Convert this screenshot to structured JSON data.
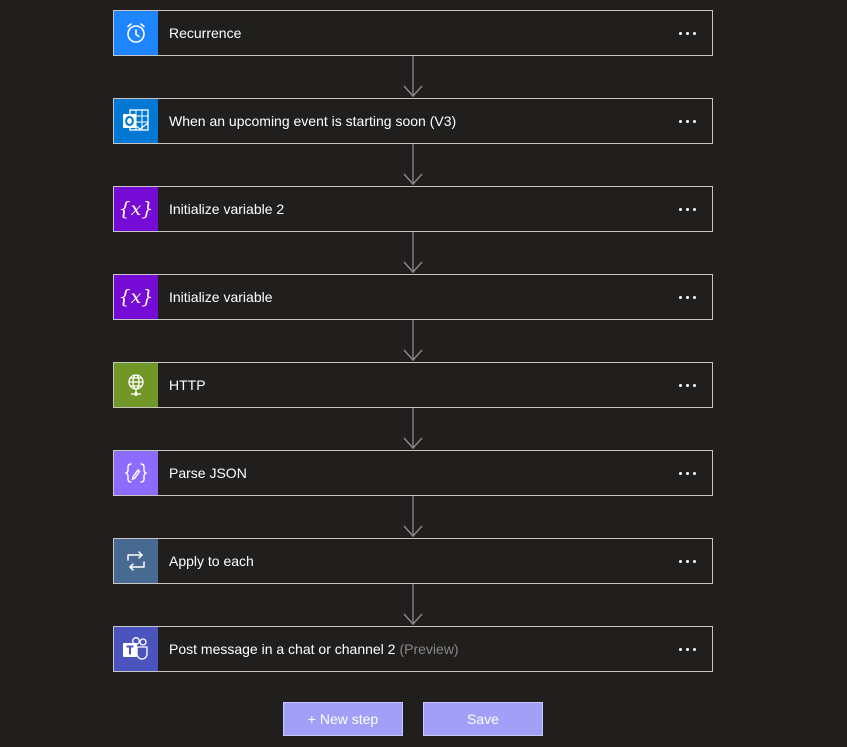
{
  "steps": [
    {
      "title": "Recurrence",
      "suffix": "",
      "icon": "alarm-clock-icon",
      "color": "#1f85ff",
      "name": "recurrence"
    },
    {
      "title": "When an upcoming event is starting soon (V3)",
      "suffix": "",
      "icon": "outlook-icon",
      "color": "#0078d4",
      "name": "upcoming-event"
    },
    {
      "title": "Initialize variable 2",
      "suffix": "",
      "icon": "variable-icon",
      "color": "#770bd6",
      "name": "initialize-variable-2"
    },
    {
      "title": "Initialize variable",
      "suffix": "",
      "icon": "variable-icon",
      "color": "#770bd6",
      "name": "initialize-variable"
    },
    {
      "title": "HTTP",
      "suffix": "",
      "icon": "globe-icon",
      "color": "#709727",
      "name": "http"
    },
    {
      "title": "Parse JSON",
      "suffix": "",
      "icon": "parse-json-icon",
      "color": "#8c6cff",
      "name": "parse-json"
    },
    {
      "title": "Apply to each",
      "suffix": "",
      "icon": "loop-icon",
      "color": "#486991",
      "name": "apply-to-each"
    },
    {
      "title": "Post message in a chat or channel 2",
      "suffix": "(Preview)",
      "icon": "teams-icon",
      "color": "#4b53bc",
      "name": "post-message"
    }
  ],
  "buttons": {
    "new_step": "+ New step",
    "save": "Save"
  }
}
